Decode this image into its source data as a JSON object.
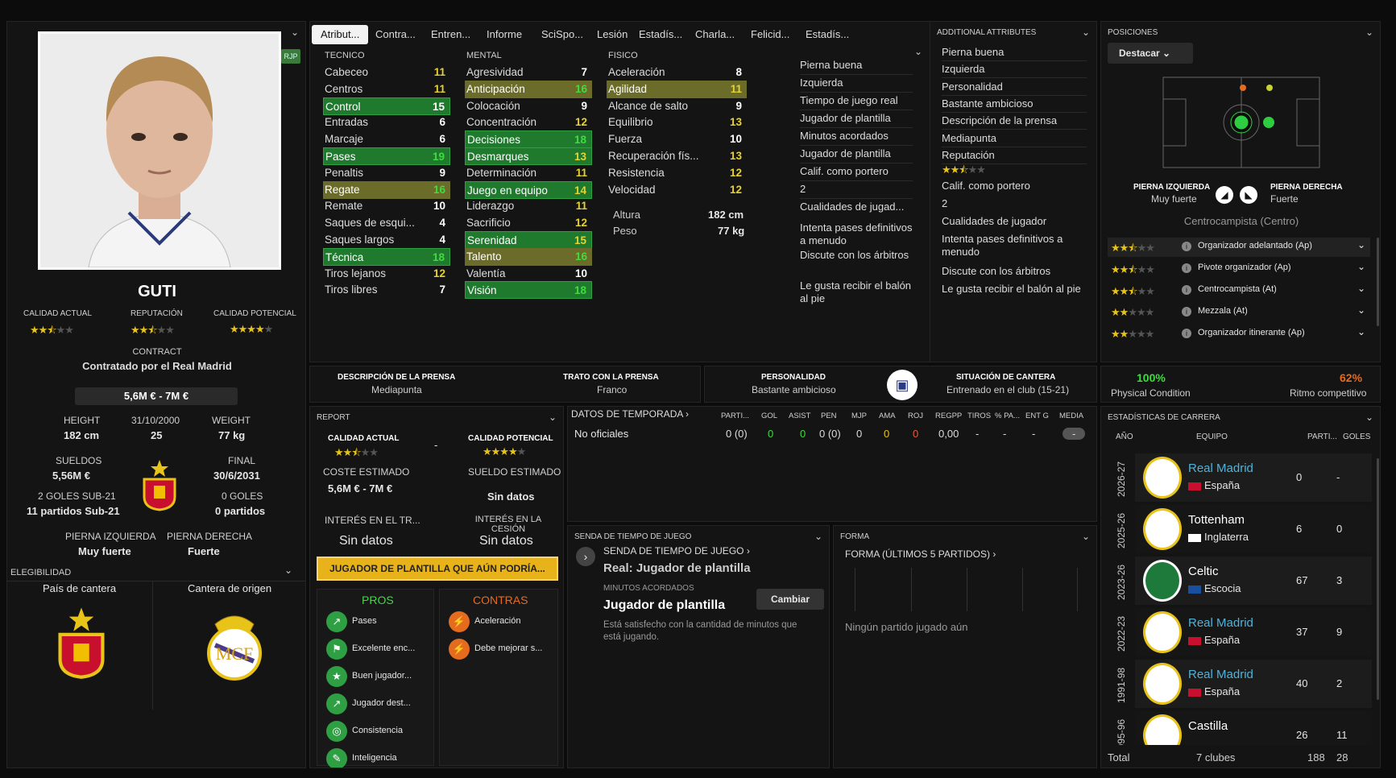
{
  "player": {
    "name": "GUTI",
    "rjp": "RJP",
    "ca_label": "CALIDAD ACTUAL",
    "rep_label": "REPUTACIÓN",
    "pa_label": "CALIDAD POTENCIAL",
    "ca_stars": 2.5,
    "rep_stars": 2.5,
    "pa_stars": 4,
    "contract_label": "CONTRACT",
    "contract": "Contratado por el Real Madrid",
    "value": "5,6M € - 7M €",
    "height_label": "HEIGHT",
    "height": "182 cm",
    "dob": "31/10/2000",
    "age": "25",
    "weight_label": "WEIGHT",
    "weight": "77 kg",
    "wages_label": "SUELDOS",
    "wages": "5,56M €",
    "final_label": "FINAL",
    "final": "30/6/2031",
    "u21_goals": "2 GOLES SUB-21",
    "u21_apps": "11 partidos Sub-21",
    "goals": "0 GOLES",
    "apps": "0 partidos",
    "left_foot_label": "PIERNA IZQUIERDA",
    "left_foot": "Muy fuerte",
    "right_foot_label": "PIERNA DERECHA",
    "right_foot": "Fuerte",
    "eligibility": "ELEGIBILIDAD",
    "youth_country": "País de cantera",
    "youth_club": "Cantera de origen"
  },
  "tabs": [
    "Atribut...",
    "Contra...",
    "Entren...",
    "Informe",
    "SciSpo...",
    "Lesión",
    "Estadís...",
    "Charla...",
    "Felicid...",
    "Estadís..."
  ],
  "tecnico": {
    "title": "TECNICO",
    "rows": [
      [
        "Cabeceo",
        "11",
        "y",
        ""
      ],
      [
        "Centros",
        "11",
        "y",
        ""
      ],
      [
        "Control",
        "15",
        "w",
        "g"
      ],
      [
        "Entradas",
        "6",
        "w",
        ""
      ],
      [
        "Marcaje",
        "6",
        "w",
        ""
      ],
      [
        "Pases",
        "19",
        "g",
        "g"
      ],
      [
        "Penaltis",
        "9",
        "w",
        ""
      ],
      [
        "Regate",
        "16",
        "g",
        "y"
      ],
      [
        "Remate",
        "10",
        "w",
        ""
      ],
      [
        "Saques de esqui...",
        "4",
        "w",
        ""
      ],
      [
        "Saques largos",
        "4",
        "w",
        ""
      ],
      [
        "Técnica",
        "18",
        "g",
        "g"
      ],
      [
        "Tiros lejanos",
        "12",
        "y",
        ""
      ],
      [
        "Tiros libres",
        "7",
        "w",
        ""
      ]
    ]
  },
  "mental": {
    "title": "MENTAL",
    "rows": [
      [
        "Agresividad",
        "7",
        "w",
        ""
      ],
      [
        "Anticipación",
        "16",
        "g",
        "y"
      ],
      [
        "Colocación",
        "9",
        "w",
        ""
      ],
      [
        "Concentración",
        "12",
        "y",
        ""
      ],
      [
        "Decisiones",
        "18",
        "g",
        "g"
      ],
      [
        "Desmarques",
        "13",
        "y",
        "g"
      ],
      [
        "Determinación",
        "11",
        "y",
        ""
      ],
      [
        "Juego en equipo",
        "14",
        "y",
        "g"
      ],
      [
        "Liderazgo",
        "11",
        "y",
        ""
      ],
      [
        "Sacrificio",
        "12",
        "y",
        ""
      ],
      [
        "Serenidad",
        "15",
        "y",
        "g"
      ],
      [
        "Talento",
        "16",
        "g",
        "y"
      ],
      [
        "Valentía",
        "10",
        "w",
        ""
      ],
      [
        "Visión",
        "18",
        "g",
        "g"
      ]
    ]
  },
  "fisico": {
    "title": "FISICO",
    "rows": [
      [
        "Aceleración",
        "8",
        "w",
        ""
      ],
      [
        "Agilidad",
        "11",
        "y",
        "y"
      ],
      [
        "Alcance de salto",
        "9",
        "w",
        ""
      ],
      [
        "Equilibrio",
        "13",
        "y",
        ""
      ],
      [
        "Fuerza",
        "10",
        "w",
        ""
      ],
      [
        "Recuperación fís...",
        "13",
        "y",
        ""
      ],
      [
        "Resistencia",
        "12",
        "y",
        ""
      ],
      [
        "Velocidad",
        "12",
        "y",
        ""
      ]
    ],
    "altura_label": "Altura",
    "altura": "182 cm",
    "peso_label": "Peso",
    "peso": "77 kg"
  },
  "side_info": [
    "Pierna buena",
    "Izquierda",
    "Tiempo de juego real",
    "Jugador de plantilla",
    "Minutos acordados",
    "Jugador de plantilla",
    "Calif. como portero",
    "2",
    "Cualidades de jugad...",
    "Intenta pases definitivos a menudo",
    "Discute con los árbitros",
    "Le gusta recibir el balón al pie"
  ],
  "additional": {
    "title": "ADDITIONAL ATTRIBUTES",
    "items": [
      "Pierna buena",
      "Izquierda",
      "Personalidad",
      "Bastante ambicioso",
      "Descripción de la prensa",
      "Mediapunta",
      "Reputación"
    ],
    "rep_stars": 2.5,
    "items2": [
      "Calif. como portero",
      "2",
      "Cualidades de jugador",
      "Intenta pases definitivos a menudo",
      "Discute con los árbitros",
      "Le gusta recibir el balón al pie"
    ]
  },
  "positions": {
    "title": "POSICIONES",
    "button": "Destacar",
    "left_foot_label": "PIERNA IZQUIERDA",
    "left_foot": "Muy fuerte",
    "right_foot_label": "PIERNA DERECHA",
    "right_foot": "Fuerte",
    "position": "Centrocampista (Centro)",
    "roles": [
      [
        "Organizador adelantado (Ap)",
        2.5
      ],
      [
        "Pivote organizador (Ap)",
        2.5
      ],
      [
        "Centrocampista (At)",
        2.5
      ],
      [
        "Mezzala (At)",
        2
      ],
      [
        "Organizador itinerante (Ap)",
        2
      ]
    ]
  },
  "press": {
    "desc_label": "DESCRIPCIÓN DE LA PRENSA",
    "desc": "Mediapunta",
    "trato_label": "TRATO CON LA PRENSA",
    "trato": "Franco",
    "pers_label": "PERSONALIDAD",
    "pers": "Bastante ambicioso",
    "cantera_label": "SITUACIÓN DE CANTERA",
    "cantera": "Entrenado en el club (15-21)"
  },
  "condition": {
    "phys": "100%",
    "phys_label": "Physical Condition",
    "ritmo": "62%",
    "ritmo_label": "Ritmo competitivo"
  },
  "report": {
    "title": "REPORT",
    "ca_label": "CALIDAD ACTUAL",
    "pa_label": "CALIDAD POTENCIAL",
    "dash": "-",
    "cost_label": "COSTE ESTIMADO",
    "cost": "5,6M € - 7M €",
    "wage_label": "SUELDO ESTIMADO",
    "wage": "Sin datos",
    "interest_label": "INTERÉS EN EL TR...",
    "interest": "Sin datos",
    "loan_label": "INTERÉS EN LA CESIÓN",
    "loan": "Sin datos",
    "banner": "JUGADOR DE PLANTILLA QUE AÚN PODRÍA...",
    "pros_title": "PROS",
    "cons_title": "CONTRAS",
    "pros": [
      "Pases",
      "Excelente enc...",
      "Buen jugador...",
      "Jugador dest...",
      "Consistencia",
      "Inteligencia"
    ],
    "cons": [
      "Aceleración",
      "Debe mejorar s..."
    ]
  },
  "season": {
    "title": "DATOS DE TEMPORADA",
    "headers": [
      "PARTI...",
      "GOL",
      "ASIST",
      "PEN",
      "MJP",
      "AMA",
      "ROJ",
      "REGPP",
      "TIROS",
      "% PA...",
      "ENT G",
      "MEDIA"
    ],
    "label": "No oficiales",
    "values": [
      "0 (0)",
      "0",
      "0",
      "0 (0)",
      "0",
      "0",
      "0",
      "0,00",
      "-",
      "-",
      "-",
      "-"
    ]
  },
  "senda": {
    "title": "SENDA DE TIEMPO DE JUEGO",
    "sub": "SENDA DE TIEMPO DE JUEGO",
    "real": "Real: Jugador de plantilla",
    "min_label": "MINUTOS ACORDADOS",
    "min": "Jugador de plantilla",
    "button": "Cambiar",
    "note": "Está satisfecho con la cantidad de minutos que está jugando."
  },
  "forma": {
    "title": "FORMA",
    "sub": "FORMA (ÚLTIMOS 5 PARTIDOS)",
    "empty": "Ningún partido jugado aún"
  },
  "career": {
    "title": "ESTADÍSTICAS DE CARRERA",
    "h_year": "AÑO",
    "h_team": "EQUIPO",
    "h_apps": "PARTI...",
    "h_goals": "GOLES",
    "rows": [
      [
        "2026-27",
        "Real Madrid",
        "España",
        "0",
        "-",
        "rm"
      ],
      [
        "2025-26",
        "Tottenham",
        "Inglaterra",
        "6",
        "0",
        "tot"
      ],
      [
        "2023-26",
        "Celtic",
        "Escocia",
        "67",
        "3",
        "cel"
      ],
      [
        "2022-23",
        "Real Madrid",
        "España",
        "37",
        "9",
        "rm"
      ],
      [
        "1991-98",
        "Real Madrid",
        "España",
        "40",
        "2",
        "rm"
      ],
      [
        "1995-96",
        "Castilla",
        "",
        "26",
        "11",
        "rm"
      ]
    ],
    "total_label": "Total",
    "total_clubs": "7 clubes",
    "total_apps": "188",
    "total_goals": "28"
  },
  "colors": {
    "green": "#2ea043",
    "yellow": "#e5d230",
    "gold": "#e8c31a",
    "link": "#4fb3d9"
  }
}
